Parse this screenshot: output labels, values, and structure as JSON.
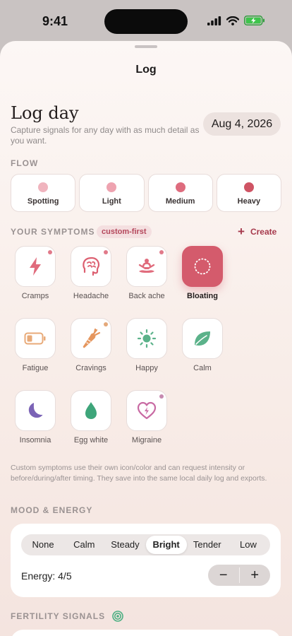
{
  "status": {
    "time": "9:41"
  },
  "nav": {
    "title": "Log"
  },
  "header": {
    "title": "Log day",
    "subtitle": "Capture signals for any day with as much detail as you want.",
    "date": "Aug 4, 2026"
  },
  "flow": {
    "label": "FLOW",
    "options": [
      {
        "label": "Spotting",
        "color": "#f0b4be"
      },
      {
        "label": "Light",
        "color": "#eea3b0"
      },
      {
        "label": "Medium",
        "color": "#de6c7e"
      },
      {
        "label": "Heavy",
        "color": "#cf5464"
      }
    ]
  },
  "symptoms": {
    "label": "YOUR SYMPTOMS",
    "tag": "custom-first",
    "create_label": "Create",
    "items": [
      {
        "label": "Cramps",
        "icon": "lightning-icon",
        "selected": false,
        "dot": "#e17a8a"
      },
      {
        "label": "Headache",
        "icon": "brain-icon",
        "selected": false,
        "dot": "#e17a8a"
      },
      {
        "label": "Back ache",
        "icon": "meditation-figure-icon",
        "selected": false,
        "dot": "#e17a8a"
      },
      {
        "label": "Bloating",
        "icon": "dotted-circle-icon",
        "selected": true,
        "dot": ""
      },
      {
        "label": "Fatigue",
        "icon": "low-battery-icon",
        "selected": false,
        "dot": ""
      },
      {
        "label": "Cravings",
        "icon": "carrot-icon",
        "selected": false,
        "dot": "#e4a87a"
      },
      {
        "label": "Happy",
        "icon": "sun-icon",
        "selected": false,
        "dot": ""
      },
      {
        "label": "Calm",
        "icon": "leaf-icon",
        "selected": false,
        "dot": ""
      },
      {
        "label": "Insomnia",
        "icon": "moon-icon",
        "selected": false,
        "dot": ""
      },
      {
        "label": "Egg white",
        "icon": "drop-icon",
        "selected": false,
        "dot": ""
      },
      {
        "label": "Migraine",
        "icon": "heart-bolt-icon",
        "selected": false,
        "dot": "#c78ab0"
      }
    ]
  },
  "note": "Custom symptoms use their own icon/color and can request intensity or before/during/after timing. They save into the same local daily log and exports.",
  "mood": {
    "label": "MOOD & ENERGY",
    "options": [
      "None",
      "Calm",
      "Steady",
      "Bright",
      "Tender",
      "Low"
    ],
    "selected": "Bright",
    "energy_label": "Energy: 4/5",
    "decrement": "−",
    "increment": "+"
  },
  "fertility": {
    "label": "FERTILITY SIGNALS"
  },
  "colors": {
    "accent": "#d45b6c",
    "accent_dark": "#a6394c"
  }
}
